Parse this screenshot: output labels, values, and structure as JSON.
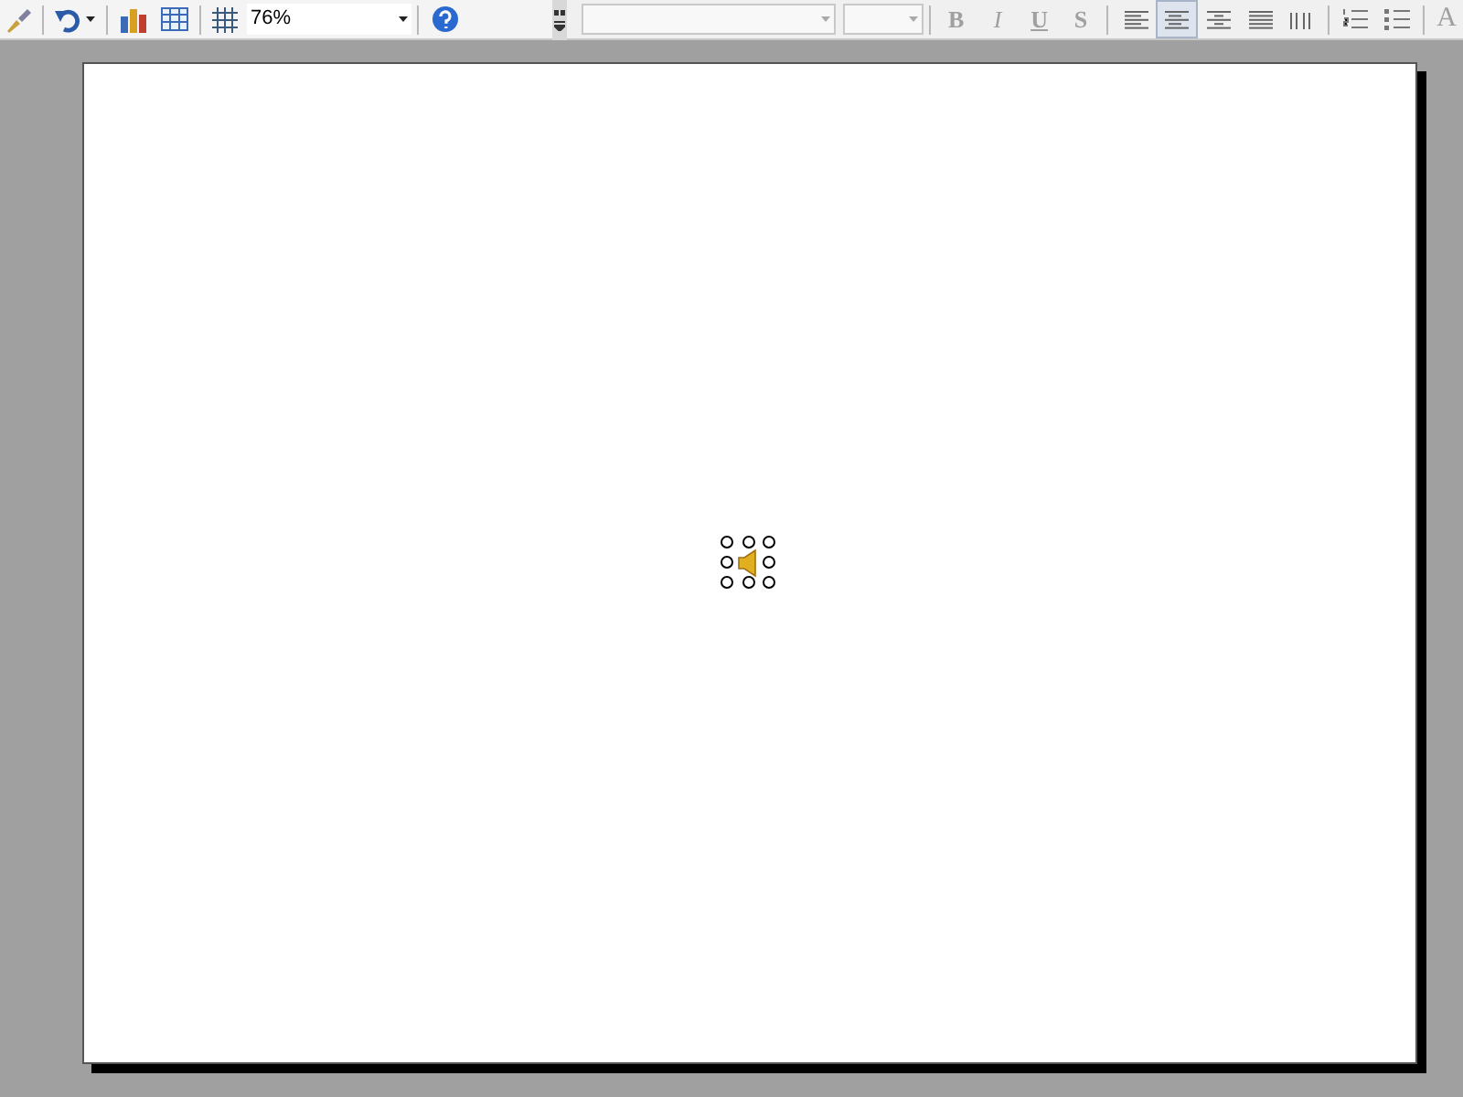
{
  "standard_toolbar": {
    "zoom": {
      "value": "76%"
    }
  },
  "format_toolbar": {
    "disabled": true,
    "style_buttons": [
      {
        "kind": "bold",
        "label": "B"
      },
      {
        "kind": "italic",
        "label": "I"
      },
      {
        "kind": "underline",
        "label": "U"
      },
      {
        "kind": "shadow",
        "label": "S"
      }
    ],
    "align_buttons": [
      {
        "kind": "left",
        "selected": false
      },
      {
        "kind": "center",
        "selected": true
      },
      {
        "kind": "right",
        "selected": false
      },
      {
        "kind": "justify",
        "selected": false
      },
      {
        "kind": "distribute",
        "selected": false
      }
    ],
    "grow_font": {
      "label": "A"
    }
  },
  "slide": {
    "sound_object": {
      "selected": true
    }
  }
}
